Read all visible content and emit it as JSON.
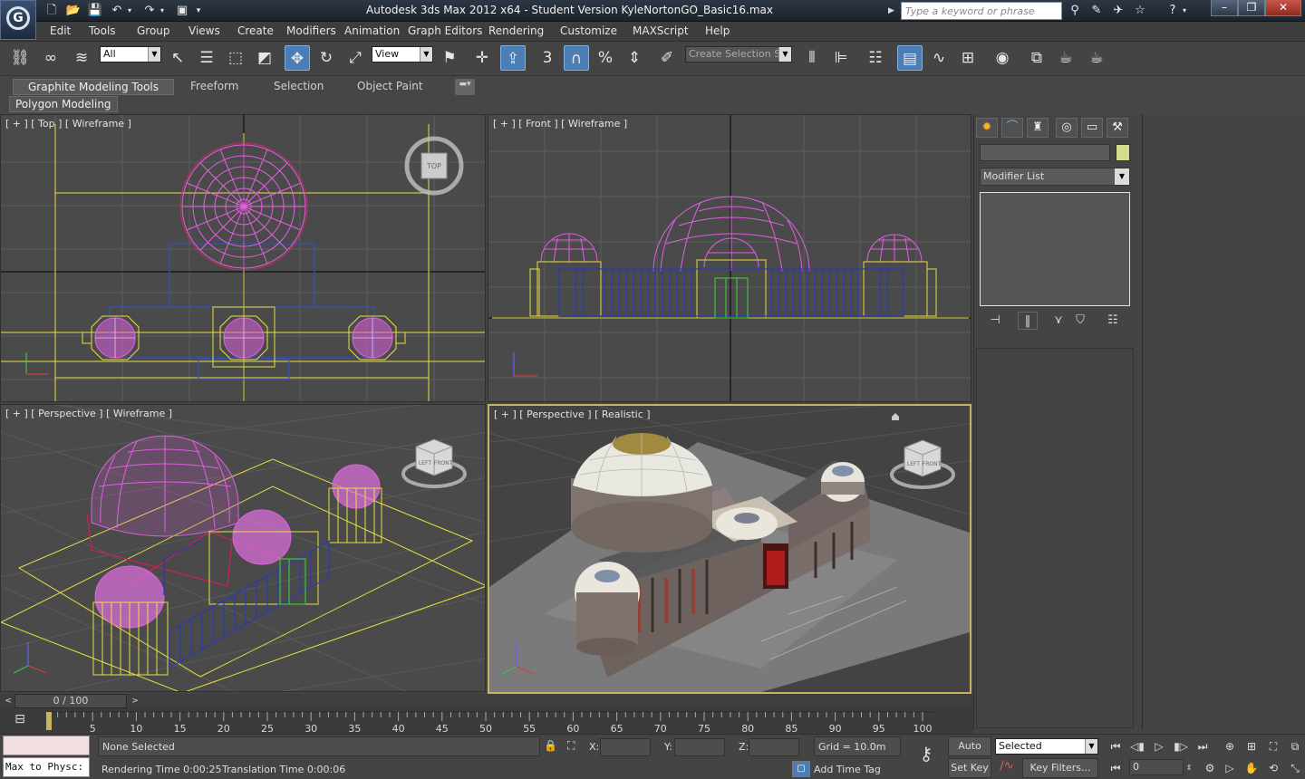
{
  "window": {
    "title": "Autodesk 3ds Max  2012 x64  -  Student Version    KyleNortonGO_Basic16.max"
  },
  "search": {
    "placeholder": "Type a keyword or phrase"
  },
  "menu": {
    "items": [
      "Edit",
      "Tools",
      "Group",
      "Views",
      "Create",
      "Modifiers",
      "Animation",
      "Graph Editors",
      "Rendering",
      "Customize",
      "MAXScript",
      "Help"
    ]
  },
  "toolbar": {
    "filter_value": "All",
    "ref_coord_value": "View",
    "named_selection_placeholder": "Create Selection Se",
    "snap_label": "3"
  },
  "ribbon": {
    "tabs": [
      "Graphite Modeling Tools",
      "Freeform",
      "Selection",
      "Object Paint"
    ],
    "panel_button": "Polygon Modeling"
  },
  "viewports": {
    "top": {
      "label": "[ + ] [ Top ] [ Wireframe ]",
      "cube": "TOP"
    },
    "front": {
      "label": "[ + ] [ Front ] [ Wireframe ]"
    },
    "persp_wire": {
      "label": "[ + ] [ Perspective ] [ Wireframe ]",
      "cube_faces": [
        "LEFT",
        "FRONT"
      ]
    },
    "persp_real": {
      "label": "[ + ] [ Perspective ] [ Realistic ]",
      "cube_faces": [
        "LEFT",
        "FRONT"
      ]
    }
  },
  "command_panel": {
    "tabs": [
      "create-icon",
      "modify-icon",
      "hierarchy-icon",
      "motion-icon",
      "display-icon",
      "utilities-icon"
    ],
    "modifier_list": "Modifier List",
    "object_color": "#d4dc90"
  },
  "timeline": {
    "slider_label": "0 / 100",
    "ticks": [
      "5",
      "10",
      "15",
      "20",
      "25",
      "30",
      "35",
      "40",
      "45",
      "50",
      "55",
      "60",
      "65",
      "70",
      "75",
      "80",
      "85",
      "90",
      "95",
      "100"
    ]
  },
  "status": {
    "maxscript_line": "Max to Physc:",
    "selection_info": "None Selected",
    "render_time": "Rendering Time  0:00:25",
    "translation_time": "Translation Time  0:00:06",
    "coord_labels": [
      "X:",
      "Y:",
      "Z:"
    ],
    "grid": "Grid = 10.0m",
    "add_time_tag": "Add Time Tag",
    "auto_key": "Auto Key",
    "set_key": "Set Key",
    "selected_value": "Selected",
    "key_filters": "Key Filters...",
    "frame_value": "0"
  },
  "colors": {
    "wire_magenta": "#e060e0",
    "wire_yellow": "#e8e040",
    "wire_blue": "#2a3ab8",
    "wire_green": "#40c040",
    "active_border": "#c8b460"
  }
}
